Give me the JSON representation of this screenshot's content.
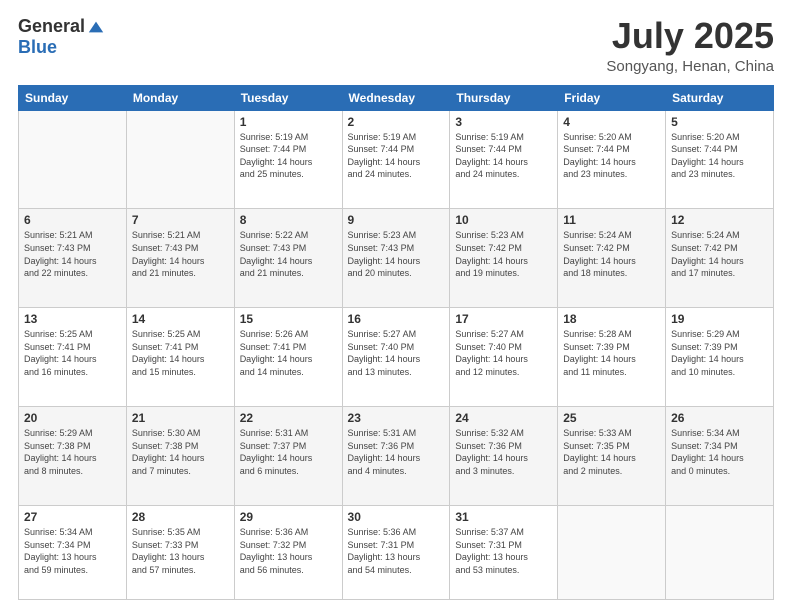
{
  "logo": {
    "general": "General",
    "blue": "Blue"
  },
  "calendar": {
    "title": "July 2025",
    "location": "Songyang, Henan, China",
    "headers": [
      "Sunday",
      "Monday",
      "Tuesday",
      "Wednesday",
      "Thursday",
      "Friday",
      "Saturday"
    ],
    "weeks": [
      [
        {
          "day": "",
          "info": ""
        },
        {
          "day": "",
          "info": ""
        },
        {
          "day": "1",
          "info": "Sunrise: 5:19 AM\nSunset: 7:44 PM\nDaylight: 14 hours\nand 25 minutes."
        },
        {
          "day": "2",
          "info": "Sunrise: 5:19 AM\nSunset: 7:44 PM\nDaylight: 14 hours\nand 24 minutes."
        },
        {
          "day": "3",
          "info": "Sunrise: 5:19 AM\nSunset: 7:44 PM\nDaylight: 14 hours\nand 24 minutes."
        },
        {
          "day": "4",
          "info": "Sunrise: 5:20 AM\nSunset: 7:44 PM\nDaylight: 14 hours\nand 23 minutes."
        },
        {
          "day": "5",
          "info": "Sunrise: 5:20 AM\nSunset: 7:44 PM\nDaylight: 14 hours\nand 23 minutes."
        }
      ],
      [
        {
          "day": "6",
          "info": "Sunrise: 5:21 AM\nSunset: 7:43 PM\nDaylight: 14 hours\nand 22 minutes."
        },
        {
          "day": "7",
          "info": "Sunrise: 5:21 AM\nSunset: 7:43 PM\nDaylight: 14 hours\nand 21 minutes."
        },
        {
          "day": "8",
          "info": "Sunrise: 5:22 AM\nSunset: 7:43 PM\nDaylight: 14 hours\nand 21 minutes."
        },
        {
          "day": "9",
          "info": "Sunrise: 5:23 AM\nSunset: 7:43 PM\nDaylight: 14 hours\nand 20 minutes."
        },
        {
          "day": "10",
          "info": "Sunrise: 5:23 AM\nSunset: 7:42 PM\nDaylight: 14 hours\nand 19 minutes."
        },
        {
          "day": "11",
          "info": "Sunrise: 5:24 AM\nSunset: 7:42 PM\nDaylight: 14 hours\nand 18 minutes."
        },
        {
          "day": "12",
          "info": "Sunrise: 5:24 AM\nSunset: 7:42 PM\nDaylight: 14 hours\nand 17 minutes."
        }
      ],
      [
        {
          "day": "13",
          "info": "Sunrise: 5:25 AM\nSunset: 7:41 PM\nDaylight: 14 hours\nand 16 minutes."
        },
        {
          "day": "14",
          "info": "Sunrise: 5:25 AM\nSunset: 7:41 PM\nDaylight: 14 hours\nand 15 minutes."
        },
        {
          "day": "15",
          "info": "Sunrise: 5:26 AM\nSunset: 7:41 PM\nDaylight: 14 hours\nand 14 minutes."
        },
        {
          "day": "16",
          "info": "Sunrise: 5:27 AM\nSunset: 7:40 PM\nDaylight: 14 hours\nand 13 minutes."
        },
        {
          "day": "17",
          "info": "Sunrise: 5:27 AM\nSunset: 7:40 PM\nDaylight: 14 hours\nand 12 minutes."
        },
        {
          "day": "18",
          "info": "Sunrise: 5:28 AM\nSunset: 7:39 PM\nDaylight: 14 hours\nand 11 minutes."
        },
        {
          "day": "19",
          "info": "Sunrise: 5:29 AM\nSunset: 7:39 PM\nDaylight: 14 hours\nand 10 minutes."
        }
      ],
      [
        {
          "day": "20",
          "info": "Sunrise: 5:29 AM\nSunset: 7:38 PM\nDaylight: 14 hours\nand 8 minutes."
        },
        {
          "day": "21",
          "info": "Sunrise: 5:30 AM\nSunset: 7:38 PM\nDaylight: 14 hours\nand 7 minutes."
        },
        {
          "day": "22",
          "info": "Sunrise: 5:31 AM\nSunset: 7:37 PM\nDaylight: 14 hours\nand 6 minutes."
        },
        {
          "day": "23",
          "info": "Sunrise: 5:31 AM\nSunset: 7:36 PM\nDaylight: 14 hours\nand 4 minutes."
        },
        {
          "day": "24",
          "info": "Sunrise: 5:32 AM\nSunset: 7:36 PM\nDaylight: 14 hours\nand 3 minutes."
        },
        {
          "day": "25",
          "info": "Sunrise: 5:33 AM\nSunset: 7:35 PM\nDaylight: 14 hours\nand 2 minutes."
        },
        {
          "day": "26",
          "info": "Sunrise: 5:34 AM\nSunset: 7:34 PM\nDaylight: 14 hours\nand 0 minutes."
        }
      ],
      [
        {
          "day": "27",
          "info": "Sunrise: 5:34 AM\nSunset: 7:34 PM\nDaylight: 13 hours\nand 59 minutes."
        },
        {
          "day": "28",
          "info": "Sunrise: 5:35 AM\nSunset: 7:33 PM\nDaylight: 13 hours\nand 57 minutes."
        },
        {
          "day": "29",
          "info": "Sunrise: 5:36 AM\nSunset: 7:32 PM\nDaylight: 13 hours\nand 56 minutes."
        },
        {
          "day": "30",
          "info": "Sunrise: 5:36 AM\nSunset: 7:31 PM\nDaylight: 13 hours\nand 54 minutes."
        },
        {
          "day": "31",
          "info": "Sunrise: 5:37 AM\nSunset: 7:31 PM\nDaylight: 13 hours\nand 53 minutes."
        },
        {
          "day": "",
          "info": ""
        },
        {
          "day": "",
          "info": ""
        }
      ]
    ]
  }
}
